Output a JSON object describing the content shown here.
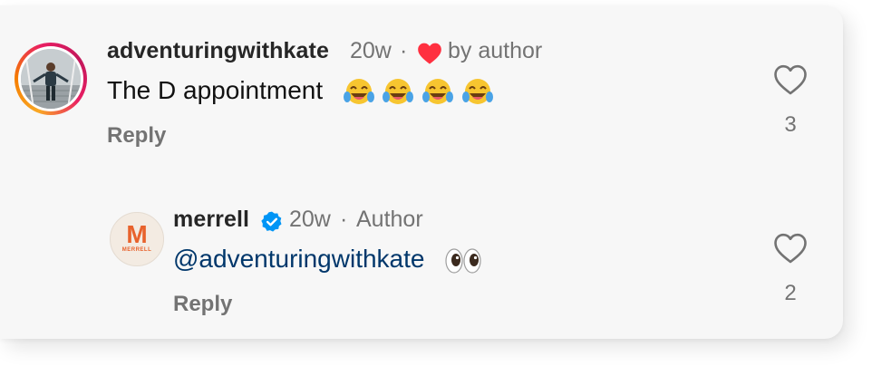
{
  "comments": [
    {
      "username": "adventuringwithkate",
      "time": "20w",
      "separator": "·",
      "liked_by_author_text": "by author",
      "text": "The D appointment",
      "emojis": [
        "face-with-tears-of-joy",
        "face-with-tears-of-joy",
        "face-with-tears-of-joy",
        "face-with-tears-of-joy"
      ],
      "reply_label": "Reply",
      "like_count": "3"
    },
    {
      "username": "merrell",
      "verified": true,
      "time": "20w",
      "separator": "·",
      "author_label": "Author",
      "mention": "@adventuringwithkate",
      "emojis": [
        "eyes"
      ],
      "reply_label": "Reply",
      "like_count": "2",
      "avatar_logo": "M",
      "avatar_logo_sub": "MERRELL"
    }
  ],
  "colors": {
    "heart_red": "#ff3040",
    "verified_blue": "#0095f6",
    "mention_blue": "#00376b",
    "brand_orange": "#e8622c",
    "muted_gray": "#737373"
  },
  "icons": {
    "like": "heart-outline-icon",
    "author_like": "heart-filled-icon",
    "verified": "verified-badge-icon"
  }
}
